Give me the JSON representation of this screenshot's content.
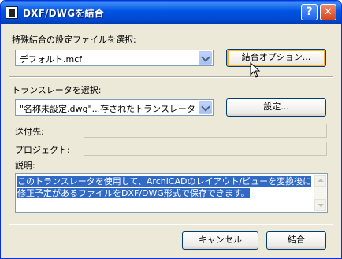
{
  "window": {
    "title": "DXF/DWGを結合"
  },
  "title_buttons": {
    "help": "?",
    "close": "✕"
  },
  "section1": {
    "label": "特殊結合の設定ファイルを選択:",
    "select_value": "デフォルト.mcf",
    "options_button": "結合オプション..."
  },
  "section2": {
    "label": "トランスレータを選択:",
    "select_value": "\"名称未設定.dwg\"...存されたトランスレータ",
    "settings_button": "設定..."
  },
  "info": {
    "send_to_label": "送付先:",
    "send_to_value": "",
    "project_label": "プロジェクト:",
    "project_value": "",
    "description_label": "説明:",
    "description_text": "このトランスレータを使用して、ArchiCADのレイアウト/ビューを変換後に修正予定があるファイルをDXF/DWG形式で保存できます。"
  },
  "footer": {
    "cancel_button": "キャンセル",
    "ok_button": "結合"
  },
  "colors": {
    "title_bar": "#0054e3",
    "dialog_bg": "#ece9d8",
    "selection": "#316ac5"
  }
}
